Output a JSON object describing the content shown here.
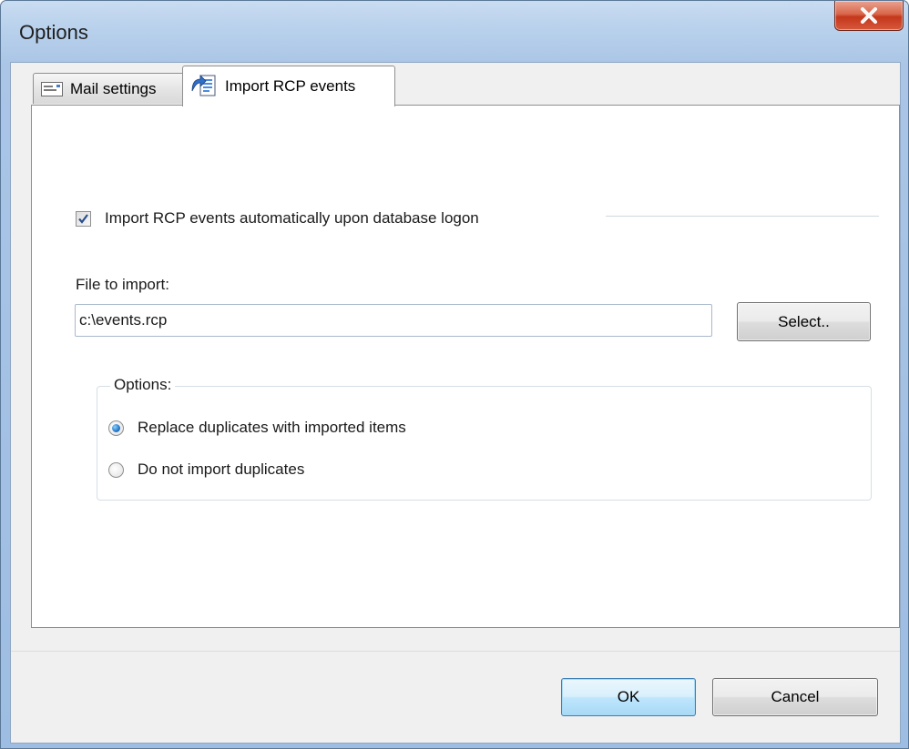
{
  "window": {
    "title": "Options",
    "close_glyph": "X",
    "close_icon": "close-icon"
  },
  "tabs": [
    {
      "label": "Mail settings",
      "icon": "mail-settings-icon",
      "selected": false
    },
    {
      "label": "Import RCP events",
      "icon": "import-events-icon",
      "selected": true
    }
  ],
  "import": {
    "auto_import_label": "Import RCP events automatically upon database logon",
    "auto_import_checked": true,
    "file_label": "File to import:",
    "file_value": "c:\\events.rcp",
    "select_button": "Select..",
    "options_group_label": "Options:",
    "options": [
      {
        "label": "Replace duplicates with imported items",
        "checked": true
      },
      {
        "label": "Do not import duplicates",
        "checked": false
      }
    ]
  },
  "footer": {
    "ok_label": "OK",
    "cancel_label": "Cancel"
  },
  "colors": {
    "title_bar": "#b9d1ec",
    "close_button": "#c4371b",
    "ok_button_border": "#3c7fb1"
  }
}
